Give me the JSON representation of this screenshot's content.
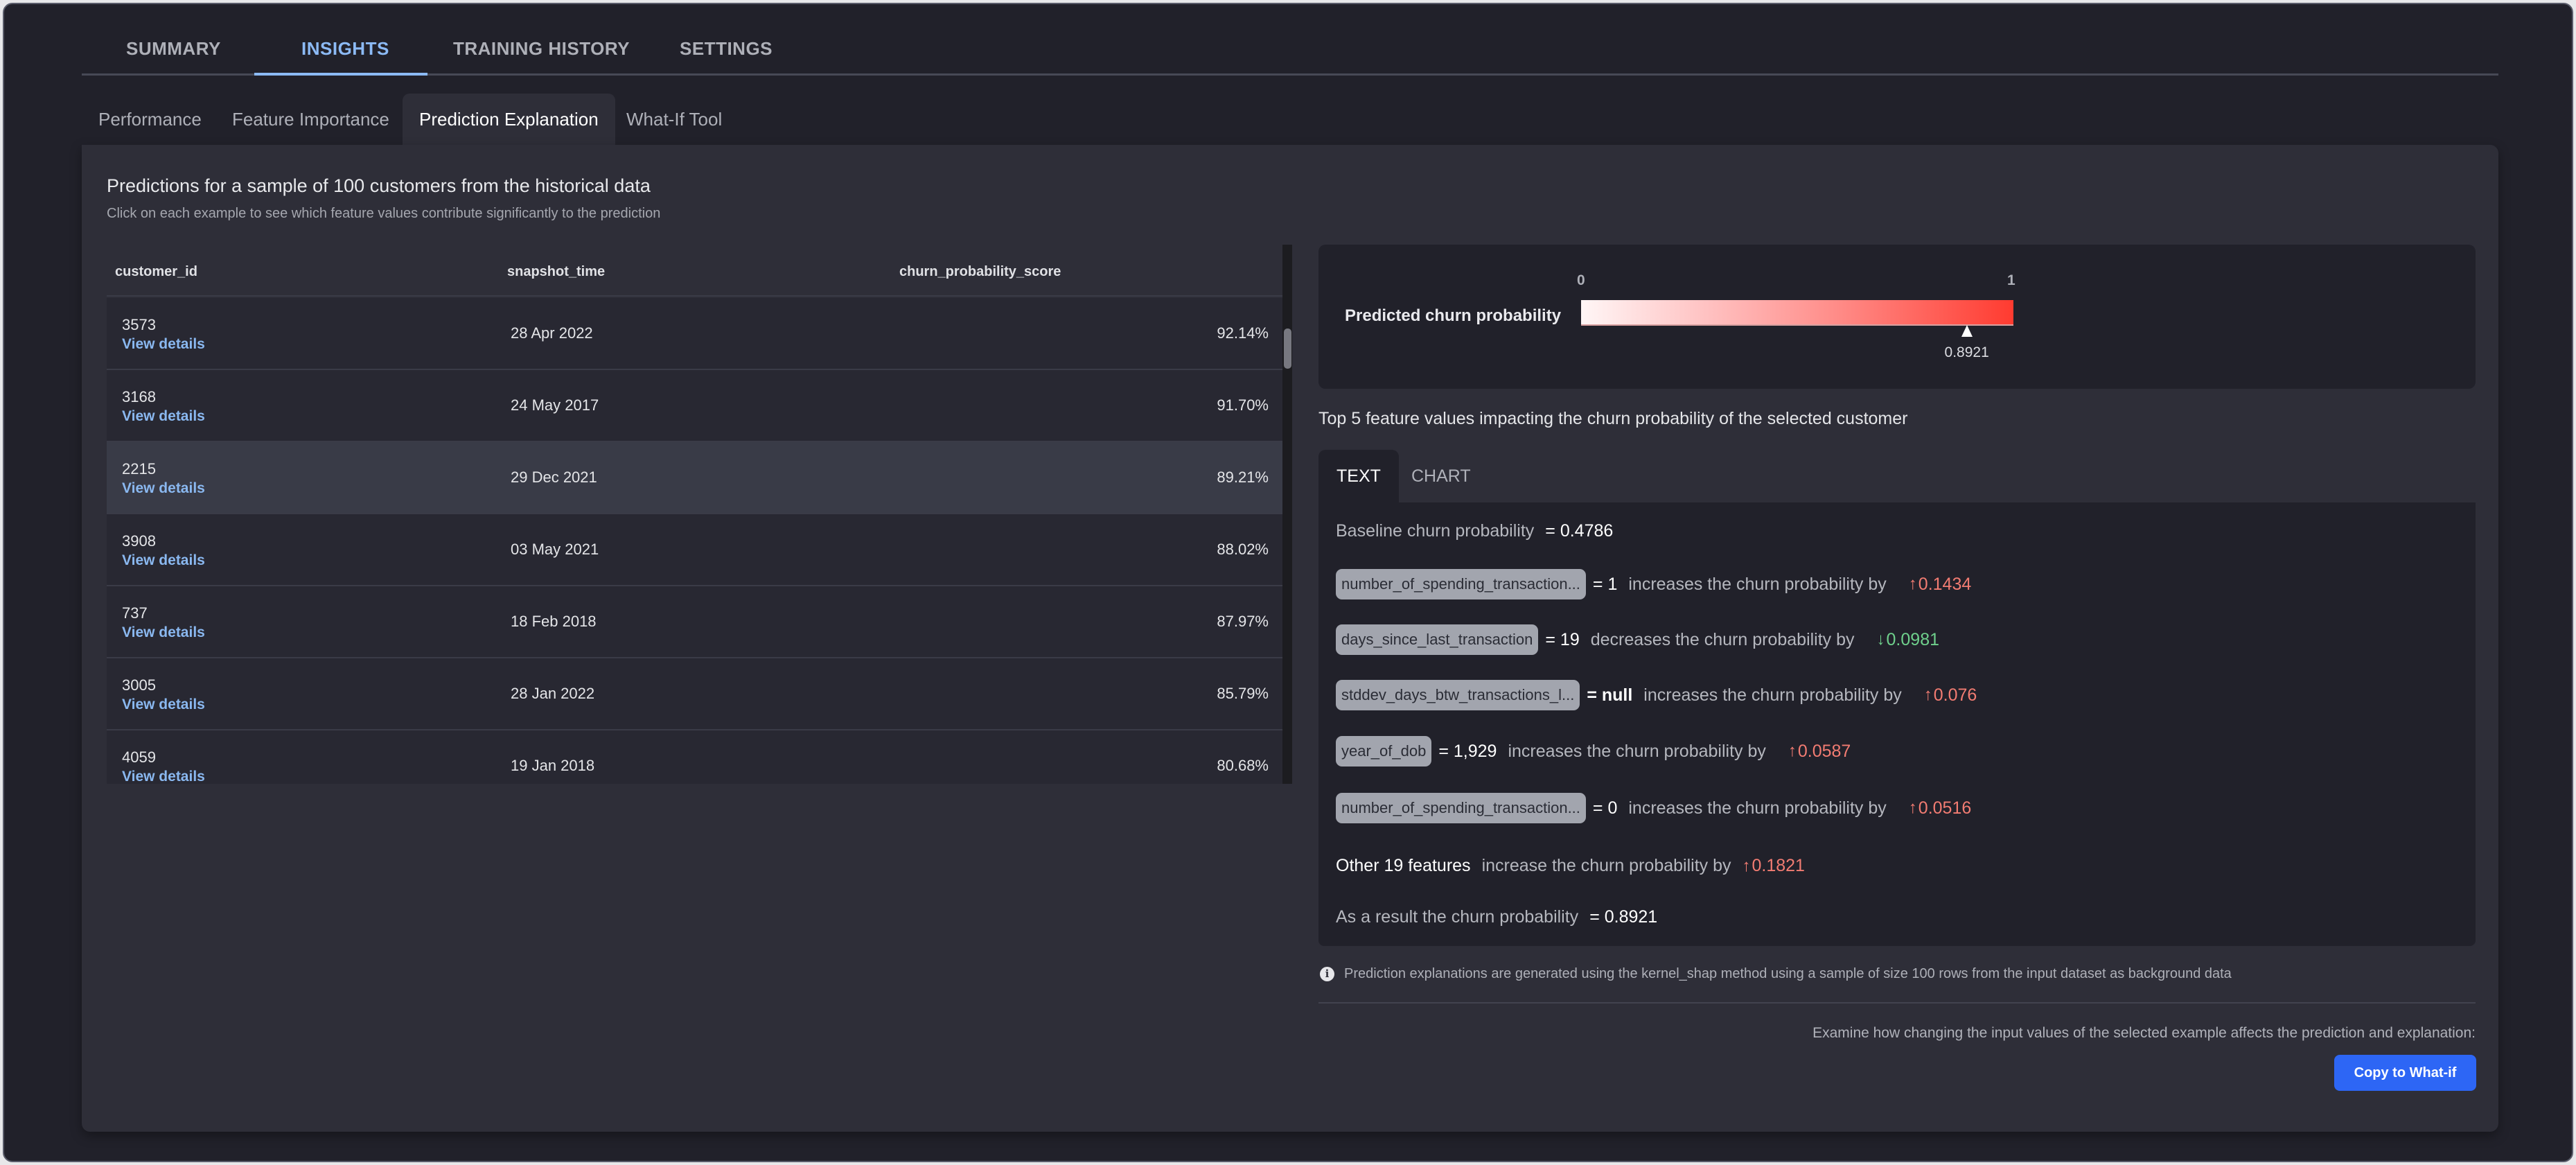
{
  "top_tabs": [
    {
      "label": "SUMMARY",
      "active": false
    },
    {
      "label": "INSIGHTS",
      "active": true
    },
    {
      "label": "TRAINING HISTORY",
      "active": false
    },
    {
      "label": "SETTINGS",
      "active": false
    }
  ],
  "sub_tabs": [
    {
      "label": "Performance",
      "active": false
    },
    {
      "label": "Feature Importance",
      "active": false
    },
    {
      "label": "Prediction Explanation",
      "active": true
    },
    {
      "label": "What-If Tool",
      "active": false
    }
  ],
  "panel": {
    "title": "Predictions for a sample of 100 customers from the historical data",
    "subtitle": "Click on each example to see which feature values contribute significantly to the prediction"
  },
  "table": {
    "columns": [
      "customer_id",
      "snapshot_time",
      "churn_probability_score"
    ],
    "link_label": "View details",
    "selected_index": 2,
    "rows": [
      {
        "customer_id": "3573",
        "snapshot_time": "28 Apr 2022",
        "score": "92.14%"
      },
      {
        "customer_id": "3168",
        "snapshot_time": "24 May 2017",
        "score": "91.70%"
      },
      {
        "customer_id": "2215",
        "snapshot_time": "29 Dec 2021",
        "score": "89.21%"
      },
      {
        "customer_id": "3908",
        "snapshot_time": "03 May 2021",
        "score": "88.02%"
      },
      {
        "customer_id": "737",
        "snapshot_time": "18 Feb 2018",
        "score": "87.97%"
      },
      {
        "customer_id": "3005",
        "snapshot_time": "28 Jan 2022",
        "score": "85.79%"
      },
      {
        "customer_id": "4059",
        "snapshot_time": "19 Jan 2018",
        "score": "80.68%"
      }
    ]
  },
  "gauge": {
    "label": "Predicted churn probability",
    "min_label": "0",
    "max_label": "1",
    "value": 0.8921,
    "value_label": "0.8921",
    "colors": {
      "low": "#fff6f6",
      "high": "#ff3b30"
    }
  },
  "explanation": {
    "title": "Top 5 feature values impacting the churn probability of the selected customer",
    "tabs": [
      {
        "label": "TEXT",
        "active": true
      },
      {
        "label": "CHART",
        "active": false
      }
    ],
    "baseline_label": "Baseline churn probability",
    "baseline_value": "= 0.4786",
    "features": [
      {
        "name": "number_of_spending_transaction...",
        "value": "= 1",
        "verb": "increases the churn probability by",
        "direction": "up",
        "impact": "0.1434"
      },
      {
        "name": "days_since_last_transaction",
        "value": "= 19",
        "verb": "decreases the churn probability by",
        "direction": "down",
        "impact": "0.0981"
      },
      {
        "name": "stddev_days_btw_transactions_l...",
        "value": "= null",
        "verb": "increases the churn probability by",
        "direction": "up",
        "impact": "0.076"
      },
      {
        "name": "year_of_dob",
        "value": "= 1,929",
        "verb": "increases the churn probability by",
        "direction": "up",
        "impact": "0.0587"
      },
      {
        "name": "number_of_spending_transaction...",
        "value": "= 0",
        "verb": "increases the churn probability by",
        "direction": "up",
        "impact": "0.0516"
      }
    ],
    "other": {
      "label": "Other 19 features",
      "verb": "increase the churn probability by",
      "direction": "up",
      "impact": "0.1821"
    },
    "result_label": "As a result the churn probability",
    "result_value": "= 0.8921",
    "arrow_up": "↑",
    "arrow_down": "↓",
    "colors": {
      "up": "#f27c72",
      "down": "#6fd08c"
    }
  },
  "footer": {
    "info_icon": "info-icon",
    "note": "Prediction explanations are generated using the kernel_shap method using a sample of size 100 rows from the input dataset as background data",
    "examine_text": "Examine how changing the input values of the selected example affects the prediction and explanation:",
    "copy_button": "Copy to What-if",
    "button_color": "#2d66f5"
  }
}
